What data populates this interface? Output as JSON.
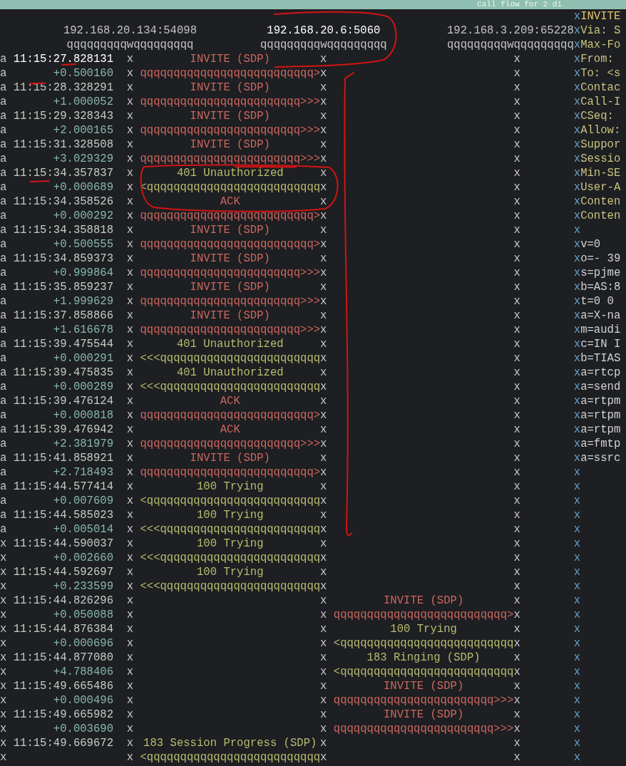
{
  "title_bar": {
    "title": "Call flow for 2 di"
  },
  "participants": [
    {
      "address": "192.168.20.134:54098",
      "selected": false,
      "lifeline": "qqqqqqqqqwqqqqqqqqq"
    },
    {
      "address": "192.168.20.6:5060",
      "selected": true,
      "lifeline": "qqqqqqqqqwqqqqqqqqq"
    },
    {
      "address": "192.168.3.209:65228",
      "selected": false,
      "lifeline": "qqqqqqqqqwqqqqqqqqq"
    }
  ],
  "messages": [
    {
      "marks": [
        "a",
        "a"
      ],
      "selected": true,
      "time": "11:15:27.828131",
      "delta": "+0.500160",
      "label": "INVITE (SDP)",
      "kind": "request",
      "second_lane": false,
      "arrow": "qqqqqqqqqqqqqqqqqqqqqqqqqq>",
      "lifelines": [
        "x",
        "x",
        "x",
        "x",
        "x",
        "x"
      ]
    },
    {
      "marks": [
        "a",
        "a"
      ],
      "selected": false,
      "time": "11:15:28.328291",
      "delta": "+1.000052",
      "label": "INVITE (SDP)",
      "kind": "request",
      "second_lane": false,
      "arrow": "qqqqqqqqqqqqqqqqqqqqqqqq>>>",
      "lifelines": [
        "x",
        "x",
        "x",
        "x",
        "x",
        "x"
      ]
    },
    {
      "marks": [
        "a",
        "a"
      ],
      "selected": false,
      "time": "11:15:29.328343",
      "delta": "+2.000165",
      "label": "INVITE (SDP)",
      "kind": "request",
      "second_lane": false,
      "arrow": "qqqqqqqqqqqqqqqqqqqqqqqq>>>",
      "lifelines": [
        "x",
        "x",
        "x",
        "x",
        "x",
        "x"
      ]
    },
    {
      "marks": [
        "a",
        "a"
      ],
      "selected": false,
      "time": "11:15:31.328508",
      "delta": "+3.029329",
      "label": "INVITE (SDP)",
      "kind": "request",
      "second_lane": false,
      "arrow": "qqqqqqqqqqqqqqqqqqqqqqqq>>>",
      "lifelines": [
        "x",
        "x",
        "x",
        "x",
        "x",
        "x"
      ]
    },
    {
      "marks": [
        "a",
        "a"
      ],
      "selected": false,
      "time": "11:15:34.357837",
      "delta": "+0.000689",
      "label": "401 Unauthorized",
      "kind": "response",
      "second_lane": false,
      "arrow": "<qqqqqqqqqqqqqqqqqqqqqqqqqq",
      "lifelines": [
        "x",
        "x",
        "x",
        "x",
        "x",
        "x"
      ]
    },
    {
      "marks": [
        "a",
        "a"
      ],
      "selected": false,
      "time": "11:15:34.358526",
      "delta": "+0.000292",
      "label": "ACK",
      "kind": "request",
      "second_lane": false,
      "arrow": "qqqqqqqqqqqqqqqqqqqqqqqqqq>",
      "lifelines": [
        "x",
        "x",
        "x",
        "x",
        "x",
        "x"
      ]
    },
    {
      "marks": [
        "a",
        "a"
      ],
      "selected": false,
      "time": "11:15:34.358818",
      "delta": "+0.500555",
      "label": "INVITE (SDP)",
      "kind": "request",
      "second_lane": false,
      "arrow": "qqqqqqqqqqqqqqqqqqqqqqqqqq>",
      "lifelines": [
        "x",
        "x",
        "x",
        "x",
        "x",
        "x"
      ]
    },
    {
      "marks": [
        "a",
        "a"
      ],
      "selected": false,
      "time": "11:15:34.859373",
      "delta": "+0.999864",
      "label": "INVITE (SDP)",
      "kind": "request",
      "second_lane": false,
      "arrow": "qqqqqqqqqqqqqqqqqqqqqqqq>>>",
      "lifelines": [
        "x",
        "x",
        "x",
        "x",
        "x",
        "x"
      ]
    },
    {
      "marks": [
        "a",
        "a"
      ],
      "selected": false,
      "time": "11:15:35.859237",
      "delta": "+1.999629",
      "label": "INVITE (SDP)",
      "kind": "request",
      "second_lane": false,
      "arrow": "qqqqqqqqqqqqqqqqqqqqqqqq>>>",
      "lifelines": [
        "x",
        "x",
        "x",
        "x",
        "x",
        "x"
      ]
    },
    {
      "marks": [
        "a",
        "a"
      ],
      "selected": false,
      "time": "11:15:37.858866",
      "delta": "+1.616678",
      "label": "INVITE (SDP)",
      "kind": "request",
      "second_lane": false,
      "arrow": "qqqqqqqqqqqqqqqqqqqqqqqq>>>",
      "lifelines": [
        "x",
        "x",
        "x",
        "x",
        "x",
        "x"
      ]
    },
    {
      "marks": [
        "a",
        "a"
      ],
      "selected": false,
      "time": "11:15:39.475544",
      "delta": "+0.000291",
      "label": "401 Unauthorized",
      "kind": "response",
      "second_lane": false,
      "arrow": "<<<qqqqqqqqqqqqqqqqqqqqqqqq",
      "lifelines": [
        "x",
        "x",
        "x",
        "x",
        "x",
        "x"
      ]
    },
    {
      "marks": [
        "a",
        "a"
      ],
      "selected": false,
      "time": "11:15:39.475835",
      "delta": "+0.000289",
      "label": "401 Unauthorized",
      "kind": "response",
      "second_lane": false,
      "arrow": "<<<qqqqqqqqqqqqqqqqqqqqqqqq",
      "lifelines": [
        "x",
        "x",
        "x",
        "x",
        "x",
        "x"
      ]
    },
    {
      "marks": [
        "a",
        "a"
      ],
      "selected": false,
      "time": "11:15:39.476124",
      "delta": "+0.000818",
      "label": "ACK",
      "kind": "request",
      "second_lane": false,
      "arrow": "qqqqqqqqqqqqqqqqqqqqqqqqqq>",
      "lifelines": [
        "x",
        "x",
        "x",
        "x",
        "x",
        "x"
      ]
    },
    {
      "marks": [
        "a",
        "a"
      ],
      "selected": false,
      "time": "11:15:39.476942",
      "delta": "+2.381979",
      "label": "ACK",
      "kind": "request",
      "second_lane": false,
      "arrow": "qqqqqqqqqqqqqqqqqqqqqqqq>>>",
      "lifelines": [
        "x",
        "x",
        "x",
        "x",
        "x",
        "x"
      ]
    },
    {
      "marks": [
        "a",
        "a"
      ],
      "selected": false,
      "time": "11:15:41.858921",
      "delta": "+2.718493",
      "label": "INVITE (SDP)",
      "kind": "request",
      "second_lane": false,
      "arrow": "qqqqqqqqqqqqqqqqqqqqqqqqqq>",
      "lifelines": [
        "x",
        "x",
        "x",
        "x",
        "x",
        "x"
      ]
    },
    {
      "marks": [
        "a",
        "a"
      ],
      "selected": false,
      "time": "11:15:44.577414",
      "delta": "+0.007609",
      "label": "100 Trying",
      "kind": "response",
      "second_lane": false,
      "arrow": "<qqqqqqqqqqqqqqqqqqqqqqqqqq",
      "lifelines": [
        "x",
        "x",
        "x",
        "x",
        "x",
        "x"
      ]
    },
    {
      "marks": [
        "a",
        "a"
      ],
      "selected": false,
      "time": "11:15:44.585023",
      "delta": "+0.005014",
      "label": "100 Trying",
      "kind": "response",
      "second_lane": false,
      "arrow": "<<<qqqqqqqqqqqqqqqqqqqqqqqq",
      "lifelines": [
        "x",
        "x",
        "x",
        "x",
        "x",
        "x"
      ]
    },
    {
      "marks": [
        "x",
        "x"
      ],
      "selected": false,
      "time": "11:15:44.590037",
      "delta": "+0.002660",
      "label": "100 Trying",
      "kind": "response",
      "second_lane": false,
      "arrow": "<<<qqqqqqqqqqqqqqqqqqqqqqqq",
      "lifelines": [
        "x",
        "x",
        "x",
        "x",
        "x",
        "x"
      ]
    },
    {
      "marks": [
        "x",
        "x"
      ],
      "selected": false,
      "time": "11:15:44.592697",
      "delta": "+0.233599",
      "label": "100 Trying",
      "kind": "response",
      "second_lane": false,
      "arrow": "<<<qqqqqqqqqqqqqqqqqqqqqqqq",
      "lifelines": [
        "x",
        "x",
        "x",
        "x",
        "x",
        "x"
      ]
    },
    {
      "marks": [
        "x",
        "x"
      ],
      "selected": false,
      "time": "11:15:44.826296",
      "delta": "+0.050088",
      "label": "INVITE (SDP)",
      "kind": "request",
      "second_lane": true,
      "arrow": "qqqqqqqqqqqqqqqqqqqqqqqqqq>",
      "lifelines": [
        "x",
        "x",
        "x",
        "x",
        "x",
        "x"
      ]
    },
    {
      "marks": [
        "x",
        "x"
      ],
      "selected": false,
      "time": "11:15:44.876384",
      "delta": "+0.000696",
      "label": "100 Trying",
      "kind": "response",
      "second_lane": true,
      "arrow": "<qqqqqqqqqqqqqqqqqqqqqqqqqq",
      "lifelines": [
        "x",
        "x",
        "x",
        "x",
        "x",
        "x"
      ]
    },
    {
      "marks": [
        "x",
        "x"
      ],
      "selected": false,
      "time": "11:15:44.877080",
      "delta": "+4.788406",
      "label": "183 Ringing (SDP)",
      "kind": "response",
      "second_lane": true,
      "arrow": "<qqqqqqqqqqqqqqqqqqqqqqqqqq",
      "lifelines": [
        "x",
        "x",
        "x",
        "x",
        "x",
        "x"
      ]
    },
    {
      "marks": [
        "x",
        "x"
      ],
      "selected": false,
      "time": "11:15:49.665486",
      "delta": "+0.000496",
      "label": "INVITE (SDP)",
      "kind": "request",
      "second_lane": true,
      "arrow": "qqqqqqqqqqqqqqqqqqqqqqqq>>>",
      "lifelines": [
        "x",
        "x",
        "x",
        "x",
        "x",
        "x"
      ]
    },
    {
      "marks": [
        "x",
        "x"
      ],
      "selected": false,
      "time": "11:15:49.665982",
      "delta": "+0.003690",
      "label": "INVITE (SDP)",
      "kind": "request",
      "second_lane": true,
      "arrow": "qqqqqqqqqqqqqqqqqqqqqqqq>>>",
      "lifelines": [
        "x",
        "x",
        "x",
        "x",
        "x",
        "x"
      ]
    },
    {
      "marks": [
        "x",
        "x"
      ],
      "selected": false,
      "time": "11:15:49.669672",
      "label": "183 Session Progress (SDP)",
      "kind": "response",
      "second_lane": false,
      "arrow": "<qqqqqqqqqqqqqqqqqqqqqqqqqq",
      "lifelines": [
        "x",
        "x",
        "x",
        "x",
        "x",
        "x"
      ]
    }
  ],
  "message_panel": {
    "lines": [
      {
        "kind": "request_line",
        "border": "x",
        "text": "INVITE"
      },
      {
        "kind": "header",
        "border": "x",
        "text": "Via: S"
      },
      {
        "kind": "header",
        "border": "x",
        "text": "Max-Fo"
      },
      {
        "kind": "header",
        "border": "x",
        "text": "From:"
      },
      {
        "kind": "header",
        "border": "x",
        "text": "To: <s"
      },
      {
        "kind": "header",
        "border": "x",
        "text": "Contac"
      },
      {
        "kind": "header",
        "border": "x",
        "text": "Call-I"
      },
      {
        "kind": "header",
        "border": "x",
        "text": "CSeq:"
      },
      {
        "kind": "header",
        "border": "x",
        "text": "Allow:"
      },
      {
        "kind": "header",
        "border": "x",
        "text": "Suppor"
      },
      {
        "kind": "header",
        "border": "x",
        "text": "Sessio"
      },
      {
        "kind": "header",
        "border": "x",
        "text": "Min-SE"
      },
      {
        "kind": "header",
        "border": "x",
        "text": "User-A"
      },
      {
        "kind": "header",
        "border": "x",
        "text": "Conten"
      },
      {
        "kind": "header",
        "border": "x",
        "text": "Conten"
      },
      {
        "kind": "blank",
        "border": "x"
      },
      {
        "kind": "sdp",
        "border": "x",
        "text": "v=0"
      },
      {
        "kind": "sdp",
        "border": "x",
        "text": "o=- 39"
      },
      {
        "kind": "sdp",
        "border": "x",
        "text": "s=pjme"
      },
      {
        "kind": "sdp",
        "border": "x",
        "text": "b=AS:8"
      },
      {
        "kind": "sdp",
        "border": "x",
        "text": "t=0 0"
      },
      {
        "kind": "sdp",
        "border": "x",
        "text": "a=X-na"
      },
      {
        "kind": "sdp",
        "border": "x",
        "text": "m=audi"
      },
      {
        "kind": "sdp",
        "border": "x",
        "text": "c=IN I"
      },
      {
        "kind": "sdp",
        "border": "x",
        "text": "b=TIAS"
      },
      {
        "kind": "sdp",
        "border": "x",
        "text": "a=rtcp"
      },
      {
        "kind": "sdp",
        "border": "x",
        "text": "a=send"
      },
      {
        "kind": "sdp",
        "border": "x",
        "text": "a=rtpm"
      },
      {
        "kind": "sdp",
        "border": "x",
        "text": "a=rtpm"
      },
      {
        "kind": "sdp",
        "border": "x",
        "text": "a=rtpm"
      },
      {
        "kind": "sdp",
        "border": "x",
        "text": "a=fmtp"
      },
      {
        "kind": "sdp",
        "border": "x",
        "text": "a=ssrc"
      },
      {
        "kind": "blank",
        "border": "x"
      },
      {
        "kind": "blank",
        "border": "x"
      },
      {
        "kind": "blank",
        "border": "x"
      },
      {
        "kind": "blank",
        "border": "x"
      },
      {
        "kind": "blank",
        "border": "x"
      },
      {
        "kind": "blank",
        "border": "x"
      },
      {
        "kind": "blank",
        "border": "x"
      },
      {
        "kind": "blank",
        "border": "x"
      },
      {
        "kind": "blank",
        "border": "x"
      },
      {
        "kind": "blank",
        "border": "x"
      },
      {
        "kind": "blank",
        "border": "x"
      },
      {
        "kind": "blank",
        "border": "x"
      },
      {
        "kind": "blank",
        "border": "x"
      },
      {
        "kind": "blank",
        "border": "x"
      },
      {
        "kind": "blank",
        "border": "x"
      },
      {
        "kind": "blank",
        "border": "x"
      },
      {
        "kind": "blank",
        "border": "x"
      },
      {
        "kind": "blank",
        "border": "x"
      },
      {
        "kind": "blank",
        "border": "x"
      },
      {
        "kind": "blank",
        "border": "x"
      },
      {
        "kind": "blank",
        "border": "x"
      }
    ]
  }
}
